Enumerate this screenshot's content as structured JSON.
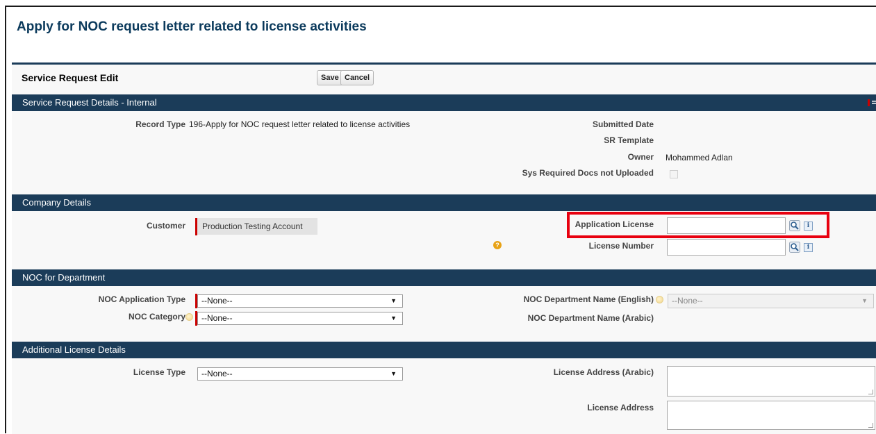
{
  "page": {
    "title": "Apply for NOC request letter related to license activities"
  },
  "panel": {
    "title": "Service Request Edit",
    "save_label": "Save",
    "cancel_label": "Cancel"
  },
  "sections": {
    "internal": {
      "title": "Service Request Details - Internal",
      "record_type_label": "Record Type",
      "record_type_value": "196-Apply for NOC request letter related to license activities",
      "submitted_date_label": "Submitted Date",
      "sr_template_label": "SR Template",
      "owner_label": "Owner",
      "owner_value": "Mohammed Adlan",
      "sys_docs_label": "Sys Required Docs not Uploaded"
    },
    "company": {
      "title": "Company Details",
      "customer_label": "Customer",
      "customer_value": "Production Testing Account",
      "application_license_label": "Application License",
      "application_license_value": "",
      "license_number_label": "License Number",
      "license_number_value": ""
    },
    "noc": {
      "title": "NOC for Department",
      "application_type_label": "NOC Application Type",
      "application_type_value": "--None--",
      "category_label": "NOC Category",
      "category_value": "--None--",
      "dept_name_en_label": "NOC Department Name (English)",
      "dept_name_en_value": "--None--",
      "dept_name_ar_label": "NOC Department Name (Arabic)"
    },
    "additional": {
      "title": "Additional License Details",
      "license_type_label": "License Type",
      "license_type_value": "--None--",
      "license_address_ar_label": "License Address (Arabic)",
      "license_address_label": "License Address"
    }
  },
  "icons": {
    "lookup": "magnifier-icon",
    "info": "info-icon",
    "info_glyph": "i",
    "help": "help-icon",
    "help_glyph": "?",
    "dropdown_arrow": "▼"
  },
  "colors": {
    "section_bar": "#1b3c59",
    "title": "#0b3a5c",
    "required": "#cc0000",
    "highlight": "#e8000f"
  }
}
